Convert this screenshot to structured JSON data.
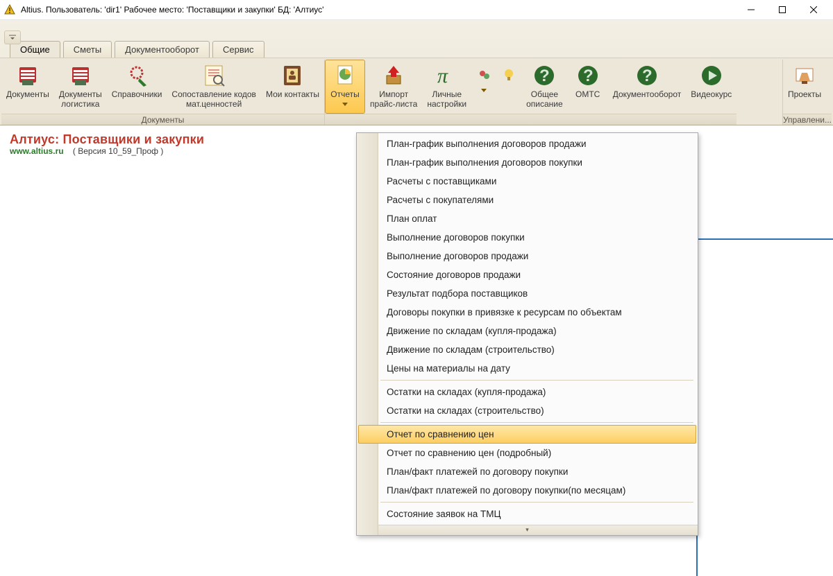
{
  "window": {
    "title": "Altius. Пользователь: 'dir1' Рабочее место: 'Поставщики и закупки' БД: 'Алтиус'"
  },
  "tabs": {
    "t0": "Общие",
    "t1": "Сметы",
    "t2": "Документооборот",
    "t3": "Сервис"
  },
  "ribbon": {
    "documents": "Документы",
    "docs_log": "Документы\nлогистика",
    "spravochniki": "Справочники",
    "sopost": "Сопоставление кодов\nмат.ценностей",
    "contacts": "Мои контакты",
    "reports": "Отчеты",
    "import": "Импорт\nпрайс-листа",
    "personal": "Личные\nнастройки",
    "general": "Общее\nописание",
    "omts": "ОМТС",
    "docflow": "Документооборот",
    "video": "Видеокурс",
    "projects": "Проекты",
    "group_docs": "Документы",
    "group_manage": "Управлени..."
  },
  "page": {
    "product": "Алтиус: Поставщики и закупки",
    "site": "www.altius.ru",
    "version_label": "( Версия 10_59_Проф     )"
  },
  "dropdown": {
    "i0": "План-график выполнения договоров продажи",
    "i1": "План-график выполнения договоров покупки",
    "i2": "Расчеты с поставщиками",
    "i3": "Расчеты с покупателями",
    "i4": "План оплат",
    "i5": "Выполнение договоров покупки",
    "i6": "Выполнение договоров продажи",
    "i7": "Состояние договоров продажи",
    "i8": "Результат подбора поставщиков",
    "i9": "Договоры покупки в привязке к ресурсам по объектам",
    "i10": "Движение по складам (купля-продажа)",
    "i11": "Движение по складам (строительство)",
    "i12": "Цены на материалы на дату",
    "i13": "Остатки на складах (купля-продажа)",
    "i14": "Остатки на складах (строительство)",
    "i15": "Отчет по сравнению цен",
    "i16": "Отчет по сравнению цен (подробный)",
    "i17": "План/факт платежей по договору покупки",
    "i18": "План/факт платежей по договору покупки(по месяцам)",
    "i19": "Состояние заявок на ТМЦ",
    "footer": "▾"
  }
}
